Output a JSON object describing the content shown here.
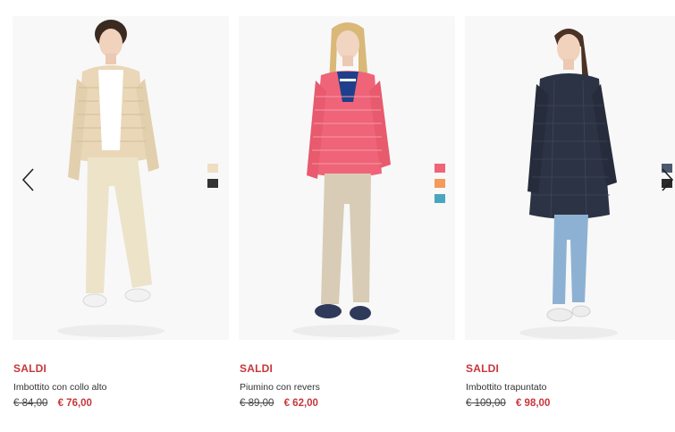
{
  "products": [
    {
      "badge": "SALDI",
      "name": "Imbottito con collo alto",
      "old_price": "€ 84,00",
      "new_price": "€ 76,00",
      "swatches": [
        "#eedfc4",
        "#333333"
      ]
    },
    {
      "badge": "SALDI",
      "name": "Piumino con revers",
      "old_price": "€ 89,00",
      "new_price": "€ 62,00",
      "swatches": [
        "#ef6478",
        "#f59a5a",
        "#4aa6c0"
      ]
    },
    {
      "badge": "SALDI",
      "name": "Imbottito trapuntato",
      "old_price": "€ 109,00",
      "new_price": "€ 98,00",
      "swatches": [
        "#4b5a6e",
        "#2b2b2b"
      ]
    }
  ],
  "nav": {
    "prev_icon": "chevron-left-icon",
    "next_icon": "chevron-right-icon"
  }
}
